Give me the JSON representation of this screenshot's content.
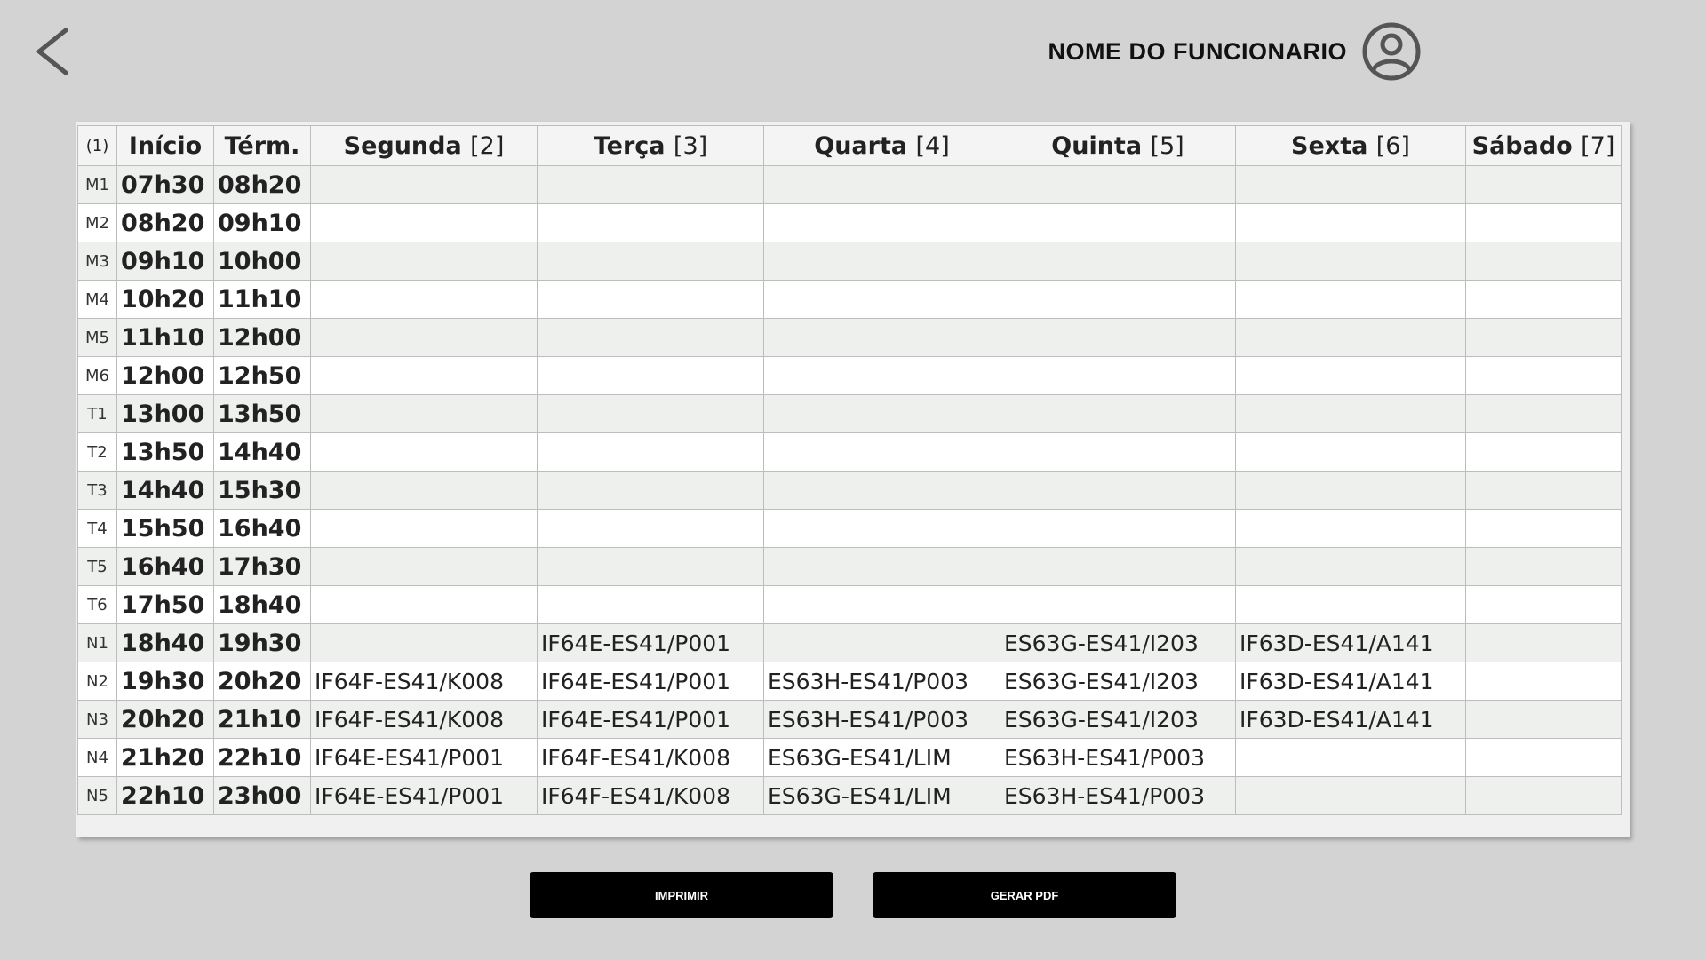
{
  "header": {
    "user_name": "NOME DO FUNCIONARIO",
    "back_icon": "chevron-left-icon",
    "avatar_icon": "user-circle-icon"
  },
  "schedule": {
    "columns": [
      {
        "label": "(1)",
        "num": ""
      },
      {
        "label": "Início",
        "num": ""
      },
      {
        "label": "Térm.",
        "num": ""
      },
      {
        "label": "Segunda ",
        "num": "[2]"
      },
      {
        "label": "Terça ",
        "num": "[3]"
      },
      {
        "label": "Quarta ",
        "num": "[4]"
      },
      {
        "label": "Quinta ",
        "num": "[5]"
      },
      {
        "label": "Sexta ",
        "num": "[6]"
      },
      {
        "label": "Sábado ",
        "num": "[7]"
      }
    ],
    "rows": [
      {
        "slot": "M1",
        "start": "07h30",
        "end": "08h20",
        "days": [
          "",
          "",
          "",
          "",
          "",
          ""
        ]
      },
      {
        "slot": "M2",
        "start": "08h20",
        "end": "09h10",
        "days": [
          "",
          "",
          "",
          "",
          "",
          ""
        ]
      },
      {
        "slot": "M3",
        "start": "09h10",
        "end": "10h00",
        "days": [
          "",
          "",
          "",
          "",
          "",
          ""
        ]
      },
      {
        "slot": "M4",
        "start": "10h20",
        "end": "11h10",
        "days": [
          "",
          "",
          "",
          "",
          "",
          ""
        ]
      },
      {
        "slot": "M5",
        "start": "11h10",
        "end": "12h00",
        "days": [
          "",
          "",
          "",
          "",
          "",
          ""
        ]
      },
      {
        "slot": "M6",
        "start": "12h00",
        "end": "12h50",
        "days": [
          "",
          "",
          "",
          "",
          "",
          ""
        ]
      },
      {
        "slot": "T1",
        "start": "13h00",
        "end": "13h50",
        "days": [
          "",
          "",
          "",
          "",
          "",
          ""
        ]
      },
      {
        "slot": "T2",
        "start": "13h50",
        "end": "14h40",
        "days": [
          "",
          "",
          "",
          "",
          "",
          ""
        ]
      },
      {
        "slot": "T3",
        "start": "14h40",
        "end": "15h30",
        "days": [
          "",
          "",
          "",
          "",
          "",
          ""
        ]
      },
      {
        "slot": "T4",
        "start": "15h50",
        "end": "16h40",
        "days": [
          "",
          "",
          "",
          "",
          "",
          ""
        ]
      },
      {
        "slot": "T5",
        "start": "16h40",
        "end": "17h30",
        "days": [
          "",
          "",
          "",
          "",
          "",
          ""
        ]
      },
      {
        "slot": "T6",
        "start": "17h50",
        "end": "18h40",
        "days": [
          "",
          "",
          "",
          "",
          "",
          ""
        ]
      },
      {
        "slot": "N1",
        "start": "18h40",
        "end": "19h30",
        "days": [
          "",
          "IF64E-ES41/P001",
          "",
          "ES63G-ES41/I203",
          "IF63D-ES41/A141",
          ""
        ]
      },
      {
        "slot": "N2",
        "start": "19h30",
        "end": "20h20",
        "days": [
          "IF64F-ES41/K008",
          "IF64E-ES41/P001",
          "ES63H-ES41/P003",
          "ES63G-ES41/I203",
          "IF63D-ES41/A141",
          ""
        ]
      },
      {
        "slot": "N3",
        "start": "20h20",
        "end": "21h10",
        "days": [
          "IF64F-ES41/K008",
          "IF64E-ES41/P001",
          "ES63H-ES41/P003",
          "ES63G-ES41/I203",
          "IF63D-ES41/A141",
          ""
        ]
      },
      {
        "slot": "N4",
        "start": "21h20",
        "end": "22h10",
        "days": [
          "IF64E-ES41/P001",
          "IF64F-ES41/K008",
          "ES63G-ES41/LIM",
          "ES63H-ES41/P003",
          "",
          ""
        ]
      },
      {
        "slot": "N5",
        "start": "22h10",
        "end": "23h00",
        "days": [
          "IF64E-ES41/P001",
          "IF64F-ES41/K008",
          "ES63G-ES41/LIM",
          "ES63H-ES41/P003",
          "",
          ""
        ]
      }
    ]
  },
  "actions": {
    "print_label": "IMPRIMIR",
    "pdf_label": "GERAR PDF"
  }
}
